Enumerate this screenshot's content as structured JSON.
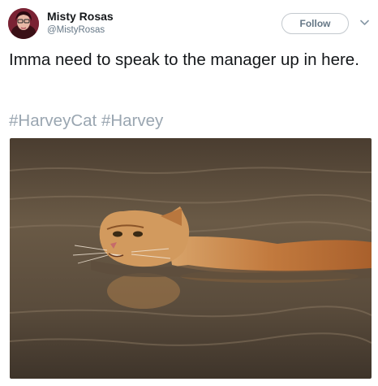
{
  "user": {
    "display_name": "Misty Rosas",
    "handle": "@MistyRosas"
  },
  "follow_button": {
    "label": "Follow"
  },
  "tweet": {
    "text": "Imma need to speak to the manager up in here.",
    "hashtags": [
      "#HarveyCat",
      "#Harvey"
    ]
  },
  "icons": {
    "more": "chevron-down-icon",
    "avatar": "avatar"
  },
  "colors": {
    "handle": "#657786",
    "hashtag": "#9aa6b1",
    "follow_border": "#c3c9ce",
    "water": "#5a4a38",
    "cat": "#c98a4a"
  }
}
